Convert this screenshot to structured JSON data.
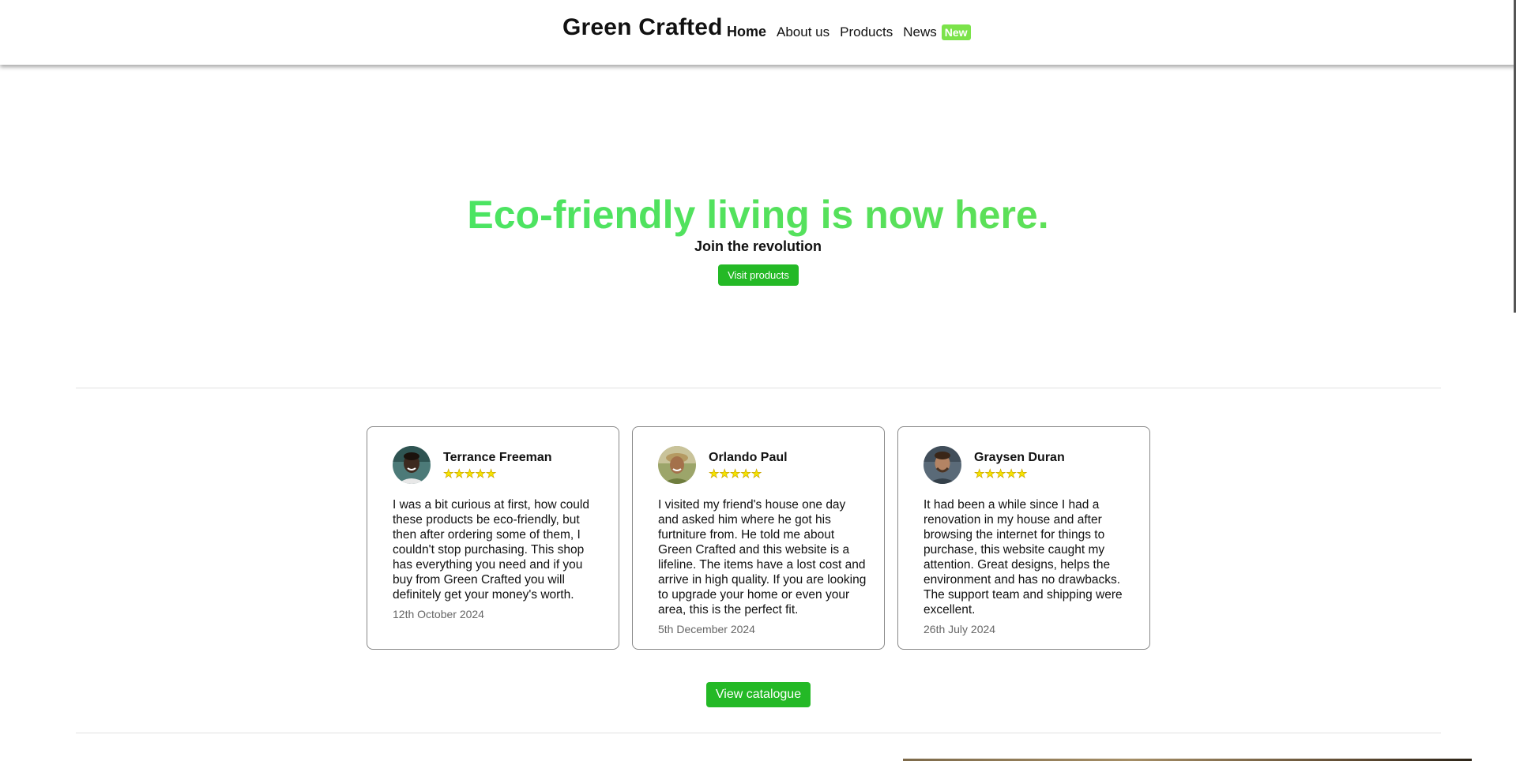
{
  "header": {
    "brand": "Green Crafted",
    "nav": {
      "home": "Home",
      "about": "About us",
      "products": "Products",
      "news": "News",
      "news_badge": "New"
    }
  },
  "hero": {
    "title": "Eco-friendly living is now here.",
    "subtitle": "Join the revolution",
    "button_label": "Visit products"
  },
  "reviews": [
    {
      "name": "Terrance Freeman",
      "rating": 5,
      "text": "I was a bit curious at first, how could these products be eco-friendly, but then after ordering some of them, I couldn't stop purchasing. This shop has everything you need and if you buy from Green Crafted you will definitely get your money's worth.",
      "date": "12th October 2024"
    },
    {
      "name": "Orlando Paul",
      "rating": 5,
      "text": "I visited my friend's house one day and asked him where he got his furtniture from. He told me about Green Crafted and this website is a lifeline. The items have a lost cost and arrive in high quality. If you are looking to upgrade your home or even your area, this is the perfect fit.",
      "date": "5th December 2024"
    },
    {
      "name": "Graysen Duran",
      "rating": 5,
      "text": "It had been a while since I had a renovation in my house and after browsing the internet for things to purchase, this website caught my attention. Great designs, helps the environment and has no drawbacks. The support team and shipping were excellent.",
      "date": "26th July 2024"
    }
  ],
  "catalogue_button": "View catalogue",
  "colors": {
    "accent_green": "#24b926",
    "hero_gradient_start": "#3de86a",
    "hero_gradient_end": "#6ee04c",
    "badge_green": "#7be34a",
    "star_yellow": "#f5e400"
  },
  "icons": {
    "rating": "star-icon"
  }
}
